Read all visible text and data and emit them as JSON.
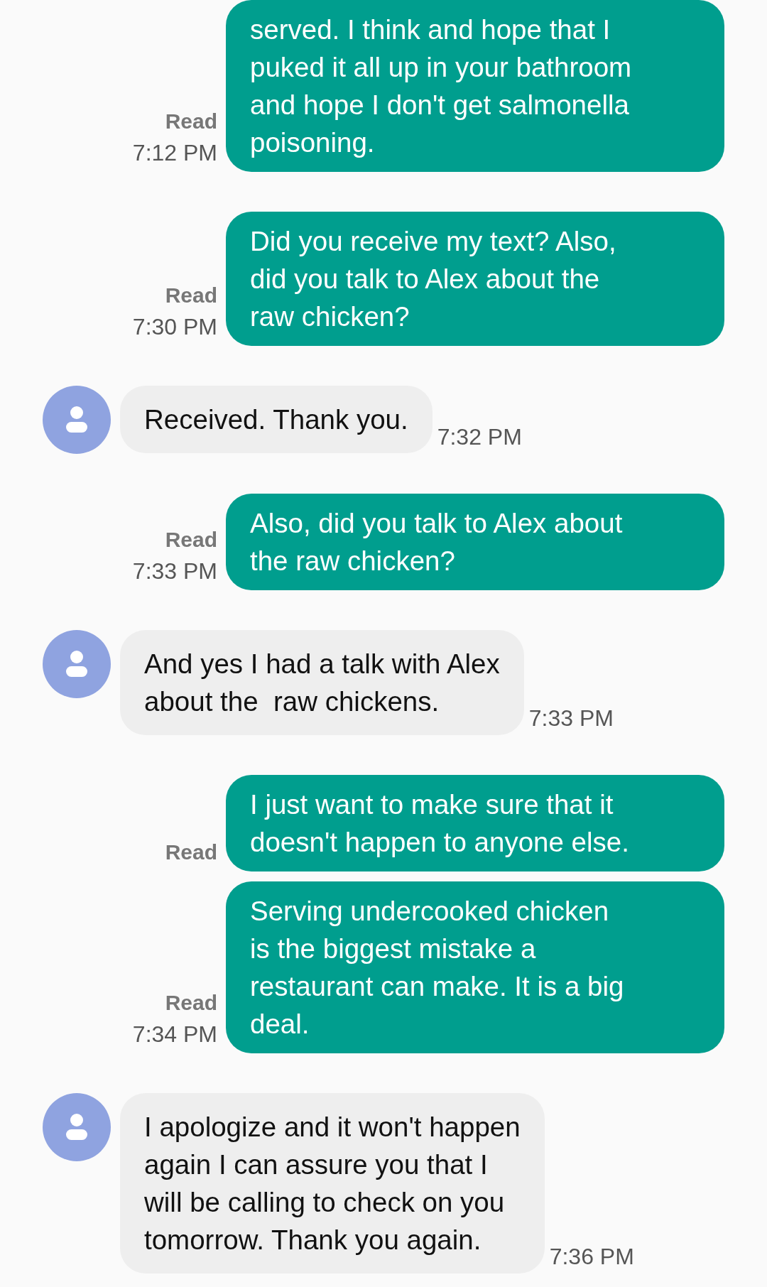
{
  "messages": [
    {
      "kind": "sent",
      "text": "served. I think and hope that I\npuked it all up in your bathroom\nand hope I don't get salmonella\npoisoning.",
      "receipt": "Read",
      "time": "7:12 PM"
    },
    {
      "kind": "sent",
      "text": "Did you receive my text? Also,\ndid you talk to Alex about the\nraw chicken?",
      "receipt": "Read",
      "time": "7:30 PM"
    },
    {
      "kind": "received",
      "text": "Received. Thank you.",
      "time": "7:32 PM"
    },
    {
      "kind": "sent",
      "text": "Also, did you talk to Alex about\nthe raw chicken?",
      "receipt": "Read",
      "time": "7:33 PM"
    },
    {
      "kind": "received",
      "text": "And yes I had a talk with Alex\nabout the  raw chickens.",
      "time": "7:33 PM"
    },
    {
      "kind": "sent",
      "text": "I just want to make sure that it\ndoesn't happen to anyone else.",
      "receipt": "Read"
    },
    {
      "kind": "sent",
      "text": "Serving undercooked chicken\nis the biggest mistake a\nrestaurant can make. It is a big\ndeal.",
      "receipt": "Read",
      "time": "7:34 PM"
    },
    {
      "kind": "received",
      "text": "I apologize and it won't happen\nagain I can assure you that I\nwill be calling to check on you\ntomorrow. Thank you again.",
      "time": "7:36 PM"
    }
  ]
}
